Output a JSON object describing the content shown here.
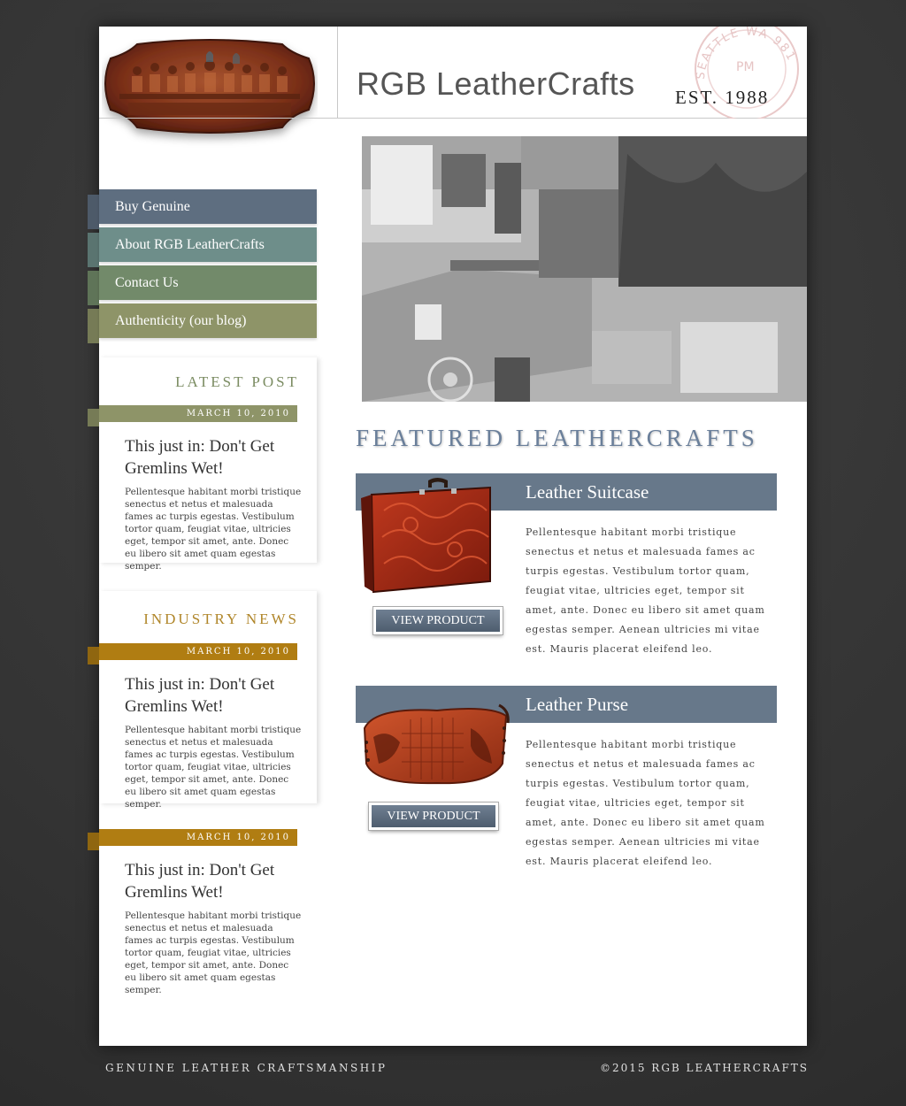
{
  "header": {
    "title": "RGB LeatherCrafts",
    "est": "EST. 1988",
    "stamp_text": "SEATTLE WA 981",
    "stamp_pm": "PM"
  },
  "nav": {
    "items": [
      {
        "label": "Buy Genuine",
        "color": "#5e6e80",
        "tab_color": "#4d5a69"
      },
      {
        "label": "About RGB LeatherCrafts",
        "color": "#6e8e8a",
        "tab_color": "#5a7470"
      },
      {
        "label": "Contact Us",
        "color": "#728a6a",
        "tab_color": "#5f7458"
      },
      {
        "label": "Authenticity (our blog)",
        "color": "#8e9468",
        "tab_color": "#767b56"
      }
    ]
  },
  "latest_post": {
    "heading": "LATEST POST",
    "heading_color": "#7b8c62",
    "date": "MARCH 10, 2010",
    "strip_color": "#8e9468",
    "title": "This just in: Don't Get Gremlins Wet!",
    "body": "Pellentesque habitant morbi tristique senectus et netus et malesuada fames ac turpis egestas. Vestibulum tortor quam, feugiat vitae, ultricies eget, tempor sit amet, ante. Donec eu libero sit amet quam egestas semper."
  },
  "industry_news": {
    "heading": "INDUSTRY NEWS",
    "heading_color": "#b0862a",
    "strip_color": "#b07d12",
    "posts": [
      {
        "date": "MARCH 10, 2010",
        "title": "This just in: Don't Get Gremlins Wet!",
        "body": "Pellentesque habitant morbi tristique senectus et netus et malesuada fames ac turpis egestas. Vestibulum tortor quam, feugiat vitae, ultricies eget, tempor sit amet, ante. Donec eu libero sit amet quam egestas semper."
      },
      {
        "date": "MARCH 10, 2010",
        "title": "This just in: Don't Get Gremlins Wet!",
        "body": "Pellentesque habitant morbi tristique senectus et netus et malesuada fames ac turpis egestas. Vestibulum tortor quam, feugiat vitae, ultricies eget, tempor sit amet, ante. Donec eu libero sit amet quam egestas semper."
      }
    ]
  },
  "featured": {
    "heading": "FEATURED LEATHERCRAFTS",
    "products": [
      {
        "title": "Leather Suitcase",
        "description": "Pellentesque habitant morbi tristique senectus et netus et malesuada fames ac turpis egestas. Vestibulum tortor quam, feugiat vitae, ultricies eget, tempor sit amet, ante. Donec eu libero sit amet quam egestas semper. Aenean ultricies mi vitae est. Mauris placerat eleifend leo.",
        "button": "VIEW PRODUCT"
      },
      {
        "title": "Leather Purse",
        "description": "Pellentesque habitant morbi tristique senectus et netus et malesuada fames ac turpis egestas. Vestibulum tortor quam, feugiat vitae, ultricies eget, tempor sit amet, ante. Donec eu libero sit amet quam egestas semper. Aenean ultricies mi vitae est. Mauris placerat eleifend leo.",
        "button": "VIEW PRODUCT"
      }
    ]
  },
  "footer": {
    "left": "GENUINE LEATHER CRAFTSMANSHIP",
    "right": "©2015 RGB LEATHERCRAFTS"
  }
}
